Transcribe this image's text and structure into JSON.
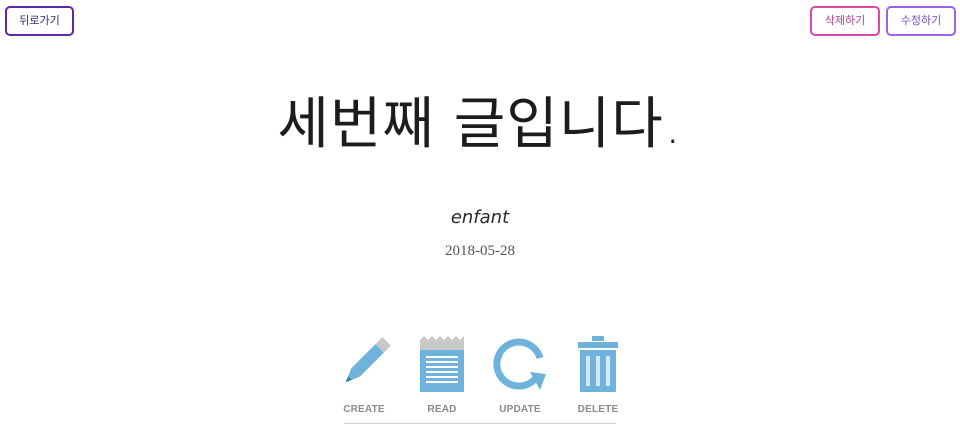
{
  "toolbar": {
    "back_label": "뒤로가기",
    "delete_label": "삭제하기",
    "edit_label": "수정하기"
  },
  "post": {
    "title": "세번째 글입니다.",
    "author": "enfant",
    "date": "2018-05-28"
  },
  "crud_banner": {
    "items": [
      {
        "label": "CREATE",
        "icon": "pencil-icon"
      },
      {
        "label": "READ",
        "icon": "notepad-icon"
      },
      {
        "label": "UPDATE",
        "icon": "refresh-icon"
      },
      {
        "label": "DELETE",
        "icon": "trash-icon"
      }
    ]
  },
  "colors": {
    "back_border": "#5b2aa8",
    "delete_border": "#e045a8",
    "edit_border": "#9a63e8",
    "icon_blue": "#6fb3dc",
    "icon_grey": "#c8c8c8"
  }
}
